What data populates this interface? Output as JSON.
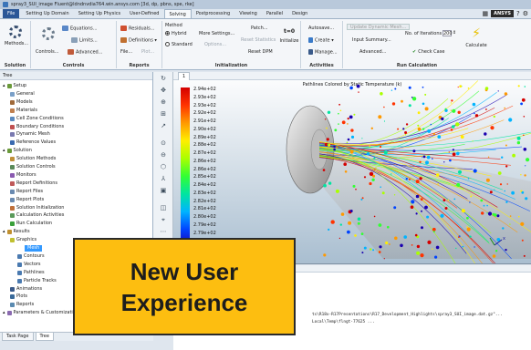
{
  "window": {
    "title": "spray3_SUI_image Fluent@ldndnvdia764.win.ansys.com [3d, dp, pbns, spe, rke]"
  },
  "ribbon_tabs": [
    {
      "label": "File",
      "kind": "file"
    },
    {
      "label": "Setting Up Domain"
    },
    {
      "label": "Setting Up Physics"
    },
    {
      "label": "User-Defined"
    },
    {
      "label": "Solving",
      "active": true
    },
    {
      "label": "Postprocessing"
    },
    {
      "label": "Viewing"
    },
    {
      "label": "Parallel"
    },
    {
      "label": "Design"
    }
  ],
  "top_right": {
    "brand": "ANSYS",
    "help_glyph": "?"
  },
  "ribbon": {
    "solution": {
      "methods": "Methods...",
      "label": "Solution"
    },
    "controls": {
      "equations": "Equations...",
      "limits": "Limits...",
      "controls": "Controls...",
      "advanced": "Advanced...",
      "label": "Controls"
    },
    "reports": {
      "residuals": "Residuals...",
      "definitions": "Definitions",
      "file": "File...",
      "plot": "Plot...",
      "label": "Reports"
    },
    "initialization": {
      "method": "Method",
      "hybrid": "Hybrid",
      "standard": "Standard",
      "more_settings": "More Settings...",
      "options": "Options...",
      "patch": "Patch...",
      "reset_statistics": "Reset Statistics",
      "reset_dpm": "Reset DPM",
      "t0": "t=0",
      "initialize": "Initialize",
      "label": "Initialization"
    },
    "activities": {
      "autosave": "Autosave...",
      "create": "Create",
      "manage": "Manage...",
      "label": "Activities"
    },
    "run_calculation": {
      "update_dynamic_mesh": "Update Dynamic Mesh...",
      "input_summary": "Input Summary...",
      "advanced": "Advanced...",
      "iterations_label": "No. of Iterations",
      "iterations_value": "200",
      "check_case": "Check Case",
      "calculate": "Calculate",
      "label": "Run Calculation"
    }
  },
  "tree": {
    "header": "Tree",
    "items": [
      {
        "label": "Setup",
        "level": 0,
        "color": "#6a9a3a"
      },
      {
        "label": "General",
        "level": 1,
        "color": "#7aa0c8"
      },
      {
        "label": "Models",
        "level": 1,
        "color": "#a06a3a"
      },
      {
        "label": "Materials",
        "level": 1,
        "color": "#c08050"
      },
      {
        "label": "Cell Zone Conditions",
        "level": 1,
        "color": "#5a8ac0"
      },
      {
        "label": "Boundary Conditions",
        "level": 1,
        "color": "#c05050"
      },
      {
        "label": "Dynamic Mesh",
        "level": 1,
        "color": "#7a7ab0"
      },
      {
        "label": "Reference Values",
        "level": 1,
        "color": "#3a6ab0"
      },
      {
        "label": "Solution",
        "level": 0,
        "color": "#6a9a3a"
      },
      {
        "label": "Solution Methods",
        "level": 1,
        "color": "#c0903a"
      },
      {
        "label": "Solution Controls",
        "level": 1,
        "color": "#5a8a5a"
      },
      {
        "label": "Monitors",
        "level": 1,
        "color": "#8a5ab0"
      },
      {
        "label": "Report Definitions",
        "level": 1,
        "color": "#c05a5a"
      },
      {
        "label": "Report Files",
        "level": 1,
        "color": "#6a8ab0"
      },
      {
        "label": "Report Plots",
        "level": 1,
        "color": "#6a8ab0"
      },
      {
        "label": "Solution Initialization",
        "level": 1,
        "color": "#c0703a"
      },
      {
        "label": "Calculation Activities",
        "level": 1,
        "color": "#5a9a5a"
      },
      {
        "label": "Run Calculation",
        "level": 1,
        "color": "#3aa03a"
      },
      {
        "label": "Results",
        "level": 0,
        "color": "#c09030"
      },
      {
        "label": "Graphics",
        "level": 1,
        "color": "#c0c030"
      },
      {
        "label": "Mesh",
        "level": 2,
        "selected": true
      },
      {
        "label": "Contours",
        "level": 2,
        "color": "#4a7ab0"
      },
      {
        "label": "Vectors",
        "level": 2,
        "color": "#4a7ab0"
      },
      {
        "label": "Pathlines",
        "level": 2,
        "color": "#4a7ab0"
      },
      {
        "label": "Particle Tracks",
        "level": 2,
        "color": "#4a7ab0"
      },
      {
        "label": "Animations",
        "level": 1,
        "color": "#3a5a8a"
      },
      {
        "label": "Plots",
        "level": 1,
        "color": "#3a6a9a"
      },
      {
        "label": "Reports",
        "level": 1,
        "color": "#5a8ab0"
      },
      {
        "label": "Parameters & Customization",
        "level": 0,
        "color": "#8a6ab0"
      }
    ],
    "bottom_tabs": [
      {
        "label": "Task Page"
      },
      {
        "label": "Tree",
        "active": true
      }
    ]
  },
  "graphics": {
    "tab_label": "1",
    "title": "Pathlines Colored by Static Temperature (k)",
    "colorbar": {
      "labels": [
        "2.94e+02",
        "2.93e+02",
        "2.93e+02",
        "2.92e+02",
        "2.91e+02",
        "2.90e+02",
        "2.89e+02",
        "2.88e+02",
        "2.87e+02",
        "2.86e+02",
        "2.86e+02",
        "2.85e+02",
        "2.84e+02",
        "2.83e+02",
        "2.82e+02",
        "2.81e+02",
        "2.80e+02",
        "2.79e+02",
        "2.79e+02",
        "2.78e+02"
      ],
      "colors": [
        "#d40000",
        "#ff3300",
        "#ff9900",
        "#ffee00",
        "#aaff00",
        "#33ff33",
        "#00e5a0",
        "#00b4ff",
        "#0044ff",
        "#1a00b0"
      ]
    },
    "axis_label": "x"
  },
  "console": {
    "header": "Console",
    "lines": [
      "ts\\R18x-R17Presentations\\R17_Development_Highlights\\spray3_SUI_image.dat.gz\"...",
      "Local\\Temp\\flngt-77625 ..."
    ]
  },
  "overlay": {
    "line1": "New User",
    "line2": "Experience",
    "color": "#fdbe10"
  }
}
